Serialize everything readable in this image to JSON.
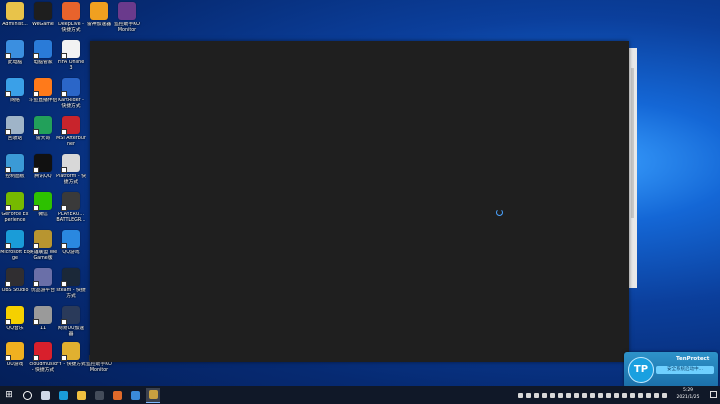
{
  "desktop": {
    "icons": [
      {
        "label": "Administ...",
        "color": "#e8c34a"
      },
      {
        "label": "WeGame",
        "color": "#1e1e1e"
      },
      {
        "label": "DeepLive - 快捷方式",
        "color": "#e8632c"
      },
      {
        "label": "雷神加速器",
        "color": "#f0a020"
      },
      {
        "label": "监控助手KO Monitor",
        "color": "#6a3a8c"
      },
      {
        "label": "此电脑",
        "color": "#3b8fe0"
      },
      {
        "label": "电脑管家",
        "color": "#2a7bd8"
      },
      {
        "label": "FiFA Online 3",
        "color": "#f2f2f2"
      },
      {
        "label": "网络",
        "color": "#3aa0e8"
      },
      {
        "label": "斗鱼直播伴侣",
        "color": "#ff7a1a"
      },
      {
        "label": "KartRider - 快捷方式",
        "color": "#2b66c8"
      },
      {
        "label": "回收站",
        "color": "#9fb4c8"
      },
      {
        "label": "雷大哥",
        "color": "#22a05a"
      },
      {
        "label": "MSI Afterburner",
        "color": "#c8242c"
      },
      {
        "label": "控制面板",
        "color": "#3b9ad6"
      },
      {
        "label": "腾讯QQ",
        "color": "#111111"
      },
      {
        "label": "Platform - 快捷方式",
        "color": "#d8d8d8"
      },
      {
        "label": "GeForce Experience",
        "color": "#76b900"
      },
      {
        "label": "微信",
        "color": "#2dc100"
      },
      {
        "label": "PLAYERU... BATTLEGR...",
        "color": "#3a3a3a"
      },
      {
        "label": "Microsoft Edge",
        "color": "#1a9cd8"
      },
      {
        "label": "英雄联盟 WeGame版",
        "color": "#b89530"
      },
      {
        "label": "QQ游戏",
        "color": "#2a88e0"
      },
      {
        "label": "OBS Studio",
        "color": "#302e31"
      },
      {
        "label": "优品游平台",
        "color": "#6a6fa8"
      },
      {
        "label": "steam - 快捷方式",
        "color": "#1b2838"
      },
      {
        "label": "QQ音乐",
        "color": "#f5d000"
      },
      {
        "label": "11",
        "color": "#9a9a9a"
      },
      {
        "label": "网易UU加速器",
        "color": "#2a3a5a"
      },
      {
        "label": "UU游戏",
        "color": "#f0b020"
      },
      {
        "label": "cloudmusic - 快捷方式",
        "color": "#d8202c"
      },
      {
        "label": "FY - 快捷方式",
        "color": "#e0b030"
      },
      {
        "label": "监控助手KO Monitor",
        "color": "#6a3a8c"
      }
    ]
  },
  "popup": {
    "title": "TenProtect",
    "logo": "TP",
    "message": "安全系统启动中..."
  },
  "taskbar": {
    "start_icon": "windows-logo",
    "items": [
      {
        "name": "search",
        "color": "#ffffff"
      },
      {
        "name": "task-view",
        "color": "#cfd8e8"
      },
      {
        "name": "edge",
        "color": "#1a9cd8"
      },
      {
        "name": "file-explorer",
        "color": "#f0c040"
      },
      {
        "name": "app-1",
        "color": "#444c5a"
      },
      {
        "name": "app-2",
        "color": "#e06a2a"
      },
      {
        "name": "app-3",
        "color": "#3a8ad8"
      },
      {
        "name": "app-4",
        "color": "#c8a040"
      }
    ],
    "clock_time": "5:29",
    "clock_date": "2021/1/25"
  }
}
